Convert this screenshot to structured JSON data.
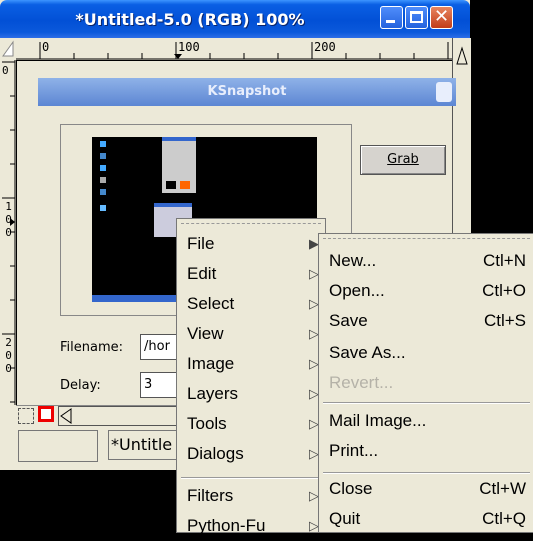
{
  "window": {
    "title": "*Untitled-5.0 (RGB) 100%"
  },
  "ruler": {
    "h_labels": [
      "0",
      "100",
      "200"
    ],
    "v_labels": [
      "0",
      "100",
      "200"
    ]
  },
  "ksnapshot": {
    "title": "KSnapshot",
    "grab_label": "Grab",
    "filename_label": "Filename:",
    "filename_value": "/hor",
    "delay_label": "Delay:",
    "delay_value": "3"
  },
  "status": {
    "text": "*Untitle"
  },
  "main_menu": {
    "items": [
      {
        "label": "File",
        "has_submenu": true
      },
      {
        "label": "Edit",
        "has_submenu": true
      },
      {
        "label": "Select",
        "has_submenu": true
      },
      {
        "label": "View",
        "has_submenu": true
      },
      {
        "label": "Image",
        "has_submenu": true
      },
      {
        "label": "Layers",
        "has_submenu": true
      },
      {
        "label": "Tools",
        "has_submenu": true
      },
      {
        "label": "Dialogs",
        "has_submenu": true
      },
      {
        "label": "Filters",
        "has_submenu": true
      },
      {
        "label": "Python-Fu",
        "has_submenu": true
      }
    ]
  },
  "file_menu": {
    "items": [
      {
        "label": "New...",
        "shortcut": "Ctl+N"
      },
      {
        "label": "Open...",
        "shortcut": "Ctl+O"
      },
      {
        "label": "Save",
        "shortcut": "Ctl+S"
      },
      {
        "label": "Save As...",
        "shortcut": ""
      },
      {
        "label": "Revert...",
        "shortcut": "",
        "disabled": true
      },
      {
        "label": "Mail Image...",
        "shortcut": ""
      },
      {
        "label": "Print...",
        "shortcut": ""
      },
      {
        "label": "Close",
        "shortcut": "Ctl+W"
      },
      {
        "label": "Quit",
        "shortcut": "Ctl+Q"
      }
    ]
  },
  "colors": {
    "titlebar": "#0250d6",
    "menu_bg": "#ece9d8",
    "disabled_text": "#b5b2a8"
  }
}
